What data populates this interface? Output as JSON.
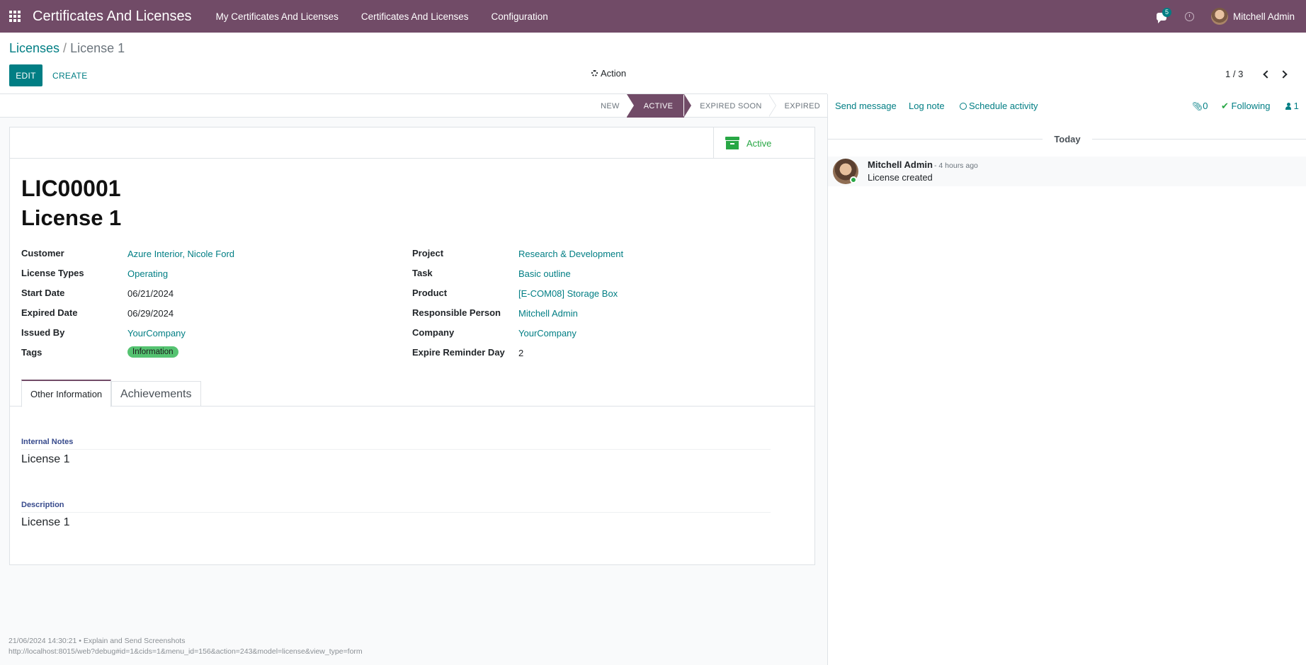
{
  "navbar": {
    "app_title": "Certificates And Licenses",
    "menu": [
      "My Certificates And Licenses",
      "Certificates And Licenses",
      "Configuration"
    ],
    "messages_count": "5",
    "user_name": "Mitchell Admin"
  },
  "breadcrumb": {
    "parent": "Licenses",
    "separator": " / ",
    "current": "License 1"
  },
  "toolbar": {
    "edit_label": "EDIT",
    "create_label": "CREATE",
    "action_label": "Action",
    "pager": "1 / 3"
  },
  "statusbar": {
    "stages": [
      "NEW",
      "ACTIVE",
      "EXPIRED SOON",
      "EXPIRED"
    ],
    "current": "ACTIVE"
  },
  "smart_button": {
    "label": "Active"
  },
  "record": {
    "reference": "LIC00001",
    "name": "License 1",
    "left_fields": [
      {
        "label": "Customer",
        "value": "Azure Interior, Nicole Ford"
      },
      {
        "label": "License Types",
        "value": "Operating"
      },
      {
        "label": "Start Date",
        "value": "06/21/2024"
      },
      {
        "label": "Expired Date",
        "value": "06/29/2024"
      },
      {
        "label": "Issued By",
        "value": "YourCompany"
      },
      {
        "label": "Tags",
        "value": "Information"
      }
    ],
    "right_fields": [
      {
        "label": "Project",
        "value": "Research & Development"
      },
      {
        "label": "Task",
        "value": "Basic outline"
      },
      {
        "label": "Product",
        "value": "[E-COM08] Storage Box"
      },
      {
        "label": "Responsible Person",
        "value": "Mitchell Admin"
      },
      {
        "label": "Company",
        "value": "YourCompany"
      },
      {
        "label": "Expire Reminder Day",
        "value": "2"
      }
    ]
  },
  "tabs": [
    "Other Information",
    "Achievements"
  ],
  "notes": {
    "internal_label": "Internal Notes",
    "internal_value": "License 1",
    "description_label": "Description",
    "description_value": "License 1"
  },
  "debug": {
    "line1": "21/06/2024 14:30:21 • Explain and Send Screenshots",
    "line2": "http://localhost:8015/web?debug#id=1&cids=1&menu_id=156&action=243&model=license&view_type=form"
  },
  "chatter": {
    "send_message": "Send message",
    "log_note": "Log note",
    "schedule_activity": "Schedule activity",
    "attachments_count": "0",
    "following": "Following",
    "followers_count": "1",
    "today": "Today",
    "message": {
      "author": "Mitchell Admin",
      "time": "- 4 hours ago",
      "body": "License created"
    }
  },
  "colors": {
    "brand": "#714b67",
    "accent": "#017e84",
    "success": "#28a745"
  }
}
